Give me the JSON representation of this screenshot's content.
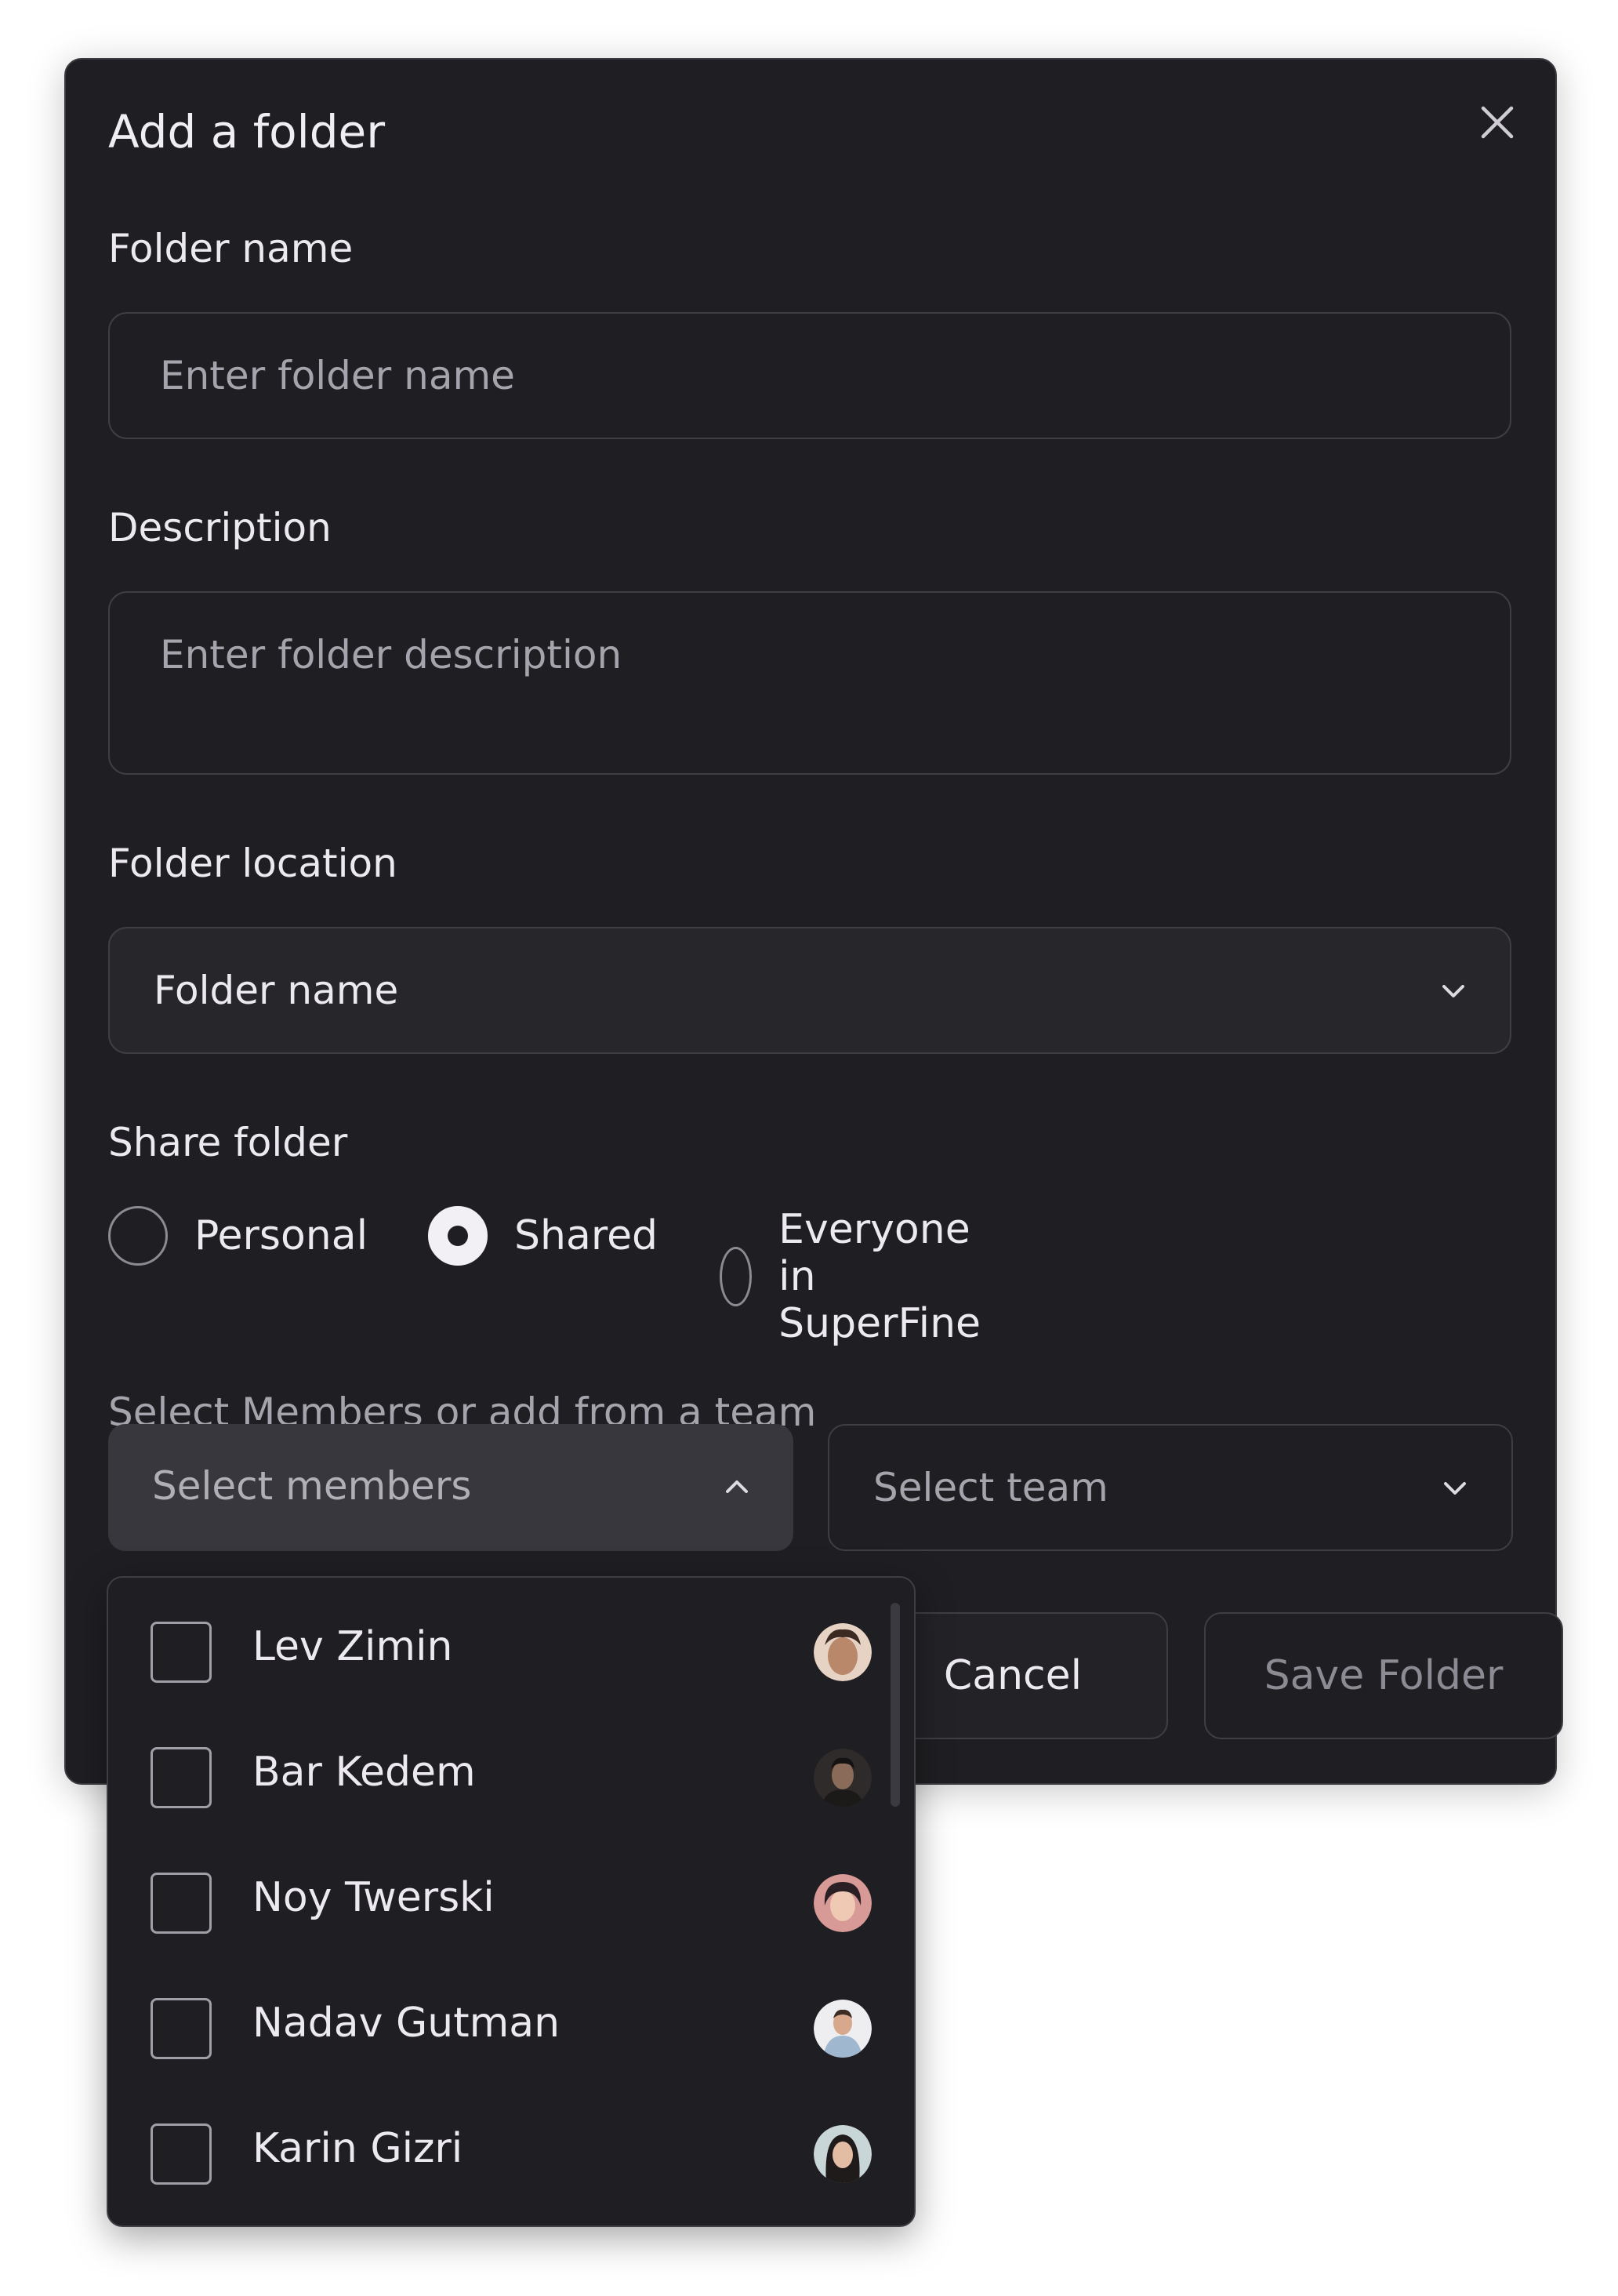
{
  "dialog": {
    "title": "Add a folder",
    "folder_name": {
      "label": "Folder name",
      "placeholder": "Enter folder name"
    },
    "description": {
      "label": "Description",
      "placeholder": "Enter folder description"
    },
    "folder_location": {
      "label": "Folder location",
      "value": "Folder name"
    },
    "share": {
      "label": "Share folder",
      "options": [
        "Personal",
        "Shared",
        "Everyone in SuperFine"
      ],
      "selected": "Shared"
    },
    "members_hint": "Select Members or add from a team",
    "members_select": {
      "placeholder": "Select members"
    },
    "team_select": {
      "placeholder": "Select team"
    },
    "buttons": {
      "cancel": "Cancel",
      "save": "Save Folder"
    }
  },
  "members_dropdown": {
    "items": [
      {
        "name": "Lev Zimin",
        "checked": false,
        "avatar_color": "#b9876a"
      },
      {
        "name": "Bar Kedem",
        "checked": false,
        "avatar_color": "#2f2b2a"
      },
      {
        "name": "Noy Twerski",
        "checked": false,
        "avatar_color": "#d79a96"
      },
      {
        "name": "Nadav Gutman",
        "checked": false,
        "avatar_color": "#e9e9ec"
      },
      {
        "name": "Karin Gizri",
        "checked": false,
        "avatar_color": "#c9d6d8"
      }
    ]
  },
  "colors": {
    "modal_bg": "#1f1e22",
    "border": "#3f3e44",
    "text": "#eceaf0",
    "muted": "#a5a3ab"
  }
}
